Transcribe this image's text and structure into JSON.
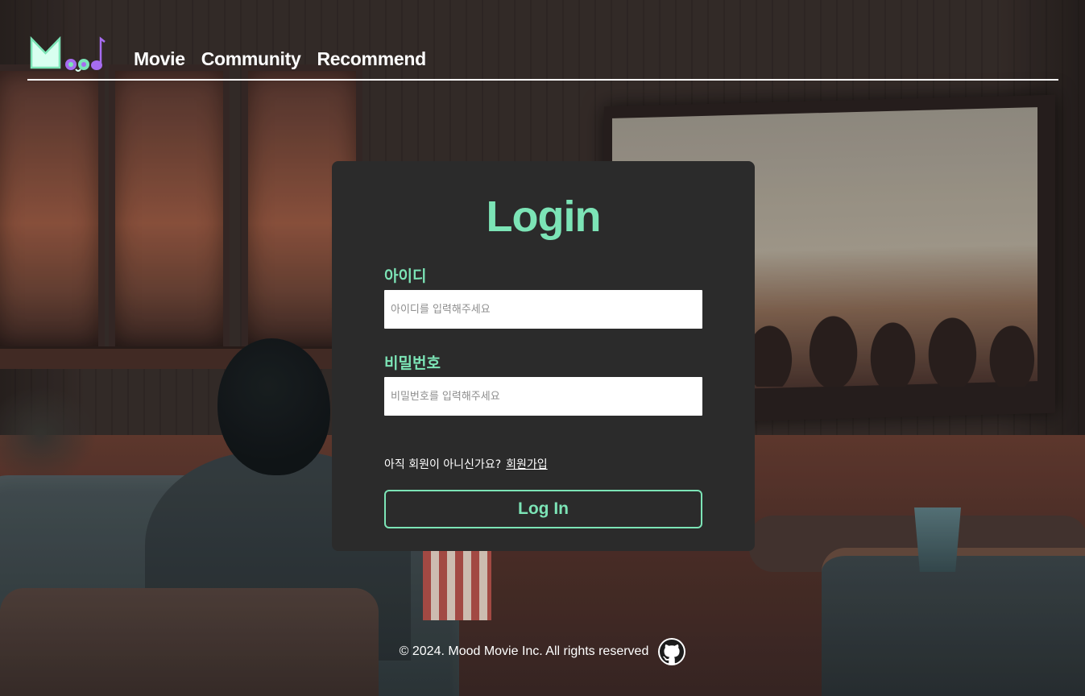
{
  "brand": {
    "logo_icon": "mood-logo-icon",
    "accent": "#7ce4b6",
    "logo_purple": "#a66cf0"
  },
  "nav": {
    "items": [
      {
        "label": "Movie"
      },
      {
        "label": "Community"
      },
      {
        "label": "Recommend"
      }
    ]
  },
  "login": {
    "title": "Login",
    "id_label": "아이디",
    "id_placeholder": "아이디를 입력해주세요",
    "password_label": "비밀번호",
    "password_placeholder": "비밀번호를 입력해주세요",
    "signup_prompt": "아직 회원이 아니신가요?",
    "signup_link": "회원가입",
    "submit": "Log In"
  },
  "footer": {
    "copyright": "© 2024. Mood Movie Inc. All rights reserved",
    "github_icon": "github-icon"
  },
  "colors": {
    "card_bg": "#2b2b2b",
    "text": "#ffffff"
  }
}
